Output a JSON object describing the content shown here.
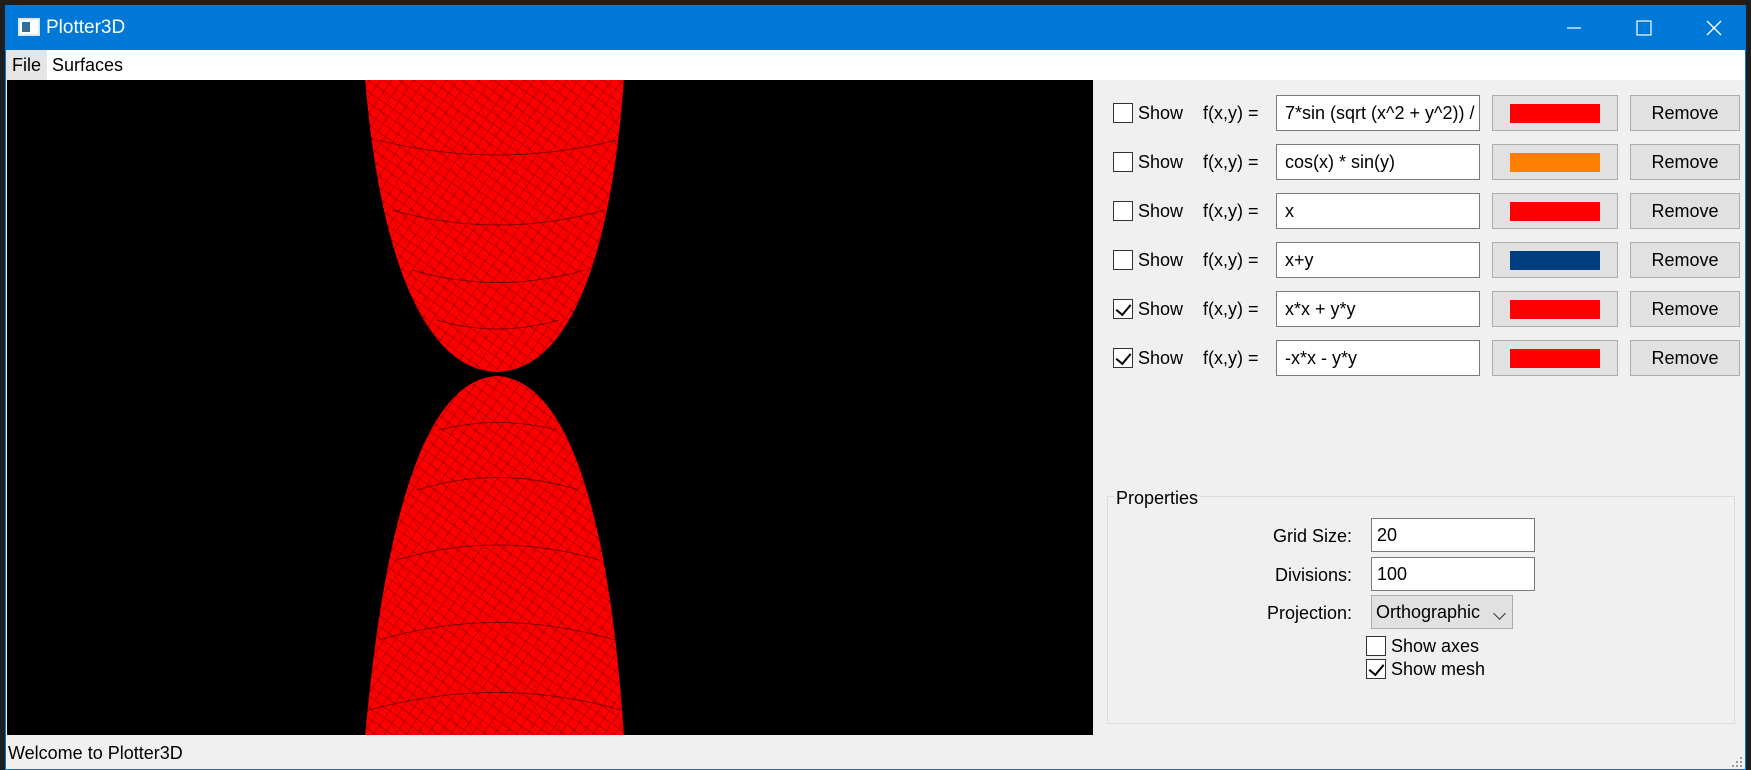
{
  "window": {
    "title": "Plotter3D",
    "accent_color": "#0078d7"
  },
  "menu": {
    "file": "File",
    "surfaces": "Surfaces"
  },
  "viewport": {
    "background": "#000000",
    "surface_color": "#ff0000",
    "mesh_color": "#000000"
  },
  "functions": [
    {
      "show_label": "Show",
      "checked": false,
      "fxy_label": "f(x,y) =",
      "expr": "7*sin (sqrt (x^2 + y^2)) /",
      "color": "#ff0000",
      "remove_label": "Remove"
    },
    {
      "show_label": "Show",
      "checked": false,
      "fxy_label": "f(x,y) =",
      "expr": "cos(x) * sin(y)",
      "color": "#ff7f00",
      "remove_label": "Remove"
    },
    {
      "show_label": "Show",
      "checked": false,
      "fxy_label": "f(x,y) =",
      "expr": "x",
      "color": "#ff0000",
      "remove_label": "Remove"
    },
    {
      "show_label": "Show",
      "checked": false,
      "fxy_label": "f(x,y) =",
      "expr": "x+y",
      "color": "#003e80",
      "remove_label": "Remove"
    },
    {
      "show_label": "Show",
      "checked": true,
      "fxy_label": "f(x,y) =",
      "expr": "x*x + y*y",
      "color": "#ff0000",
      "remove_label": "Remove"
    },
    {
      "show_label": "Show",
      "checked": true,
      "fxy_label": "f(x,y) =",
      "expr": "-x*x - y*y",
      "color": "#ff0000",
      "remove_label": "Remove"
    }
  ],
  "properties": {
    "title": "Properties",
    "grid_size_label": "Grid Size:",
    "grid_size_value": "20",
    "divisions_label": "Divisions:",
    "divisions_value": "100",
    "projection_label": "Projection:",
    "projection_value": "Orthographic",
    "show_axes_label": "Show axes",
    "show_axes_checked": false,
    "show_mesh_label": "Show mesh",
    "show_mesh_checked": true
  },
  "status": {
    "text": "Welcome to Plotter3D"
  }
}
